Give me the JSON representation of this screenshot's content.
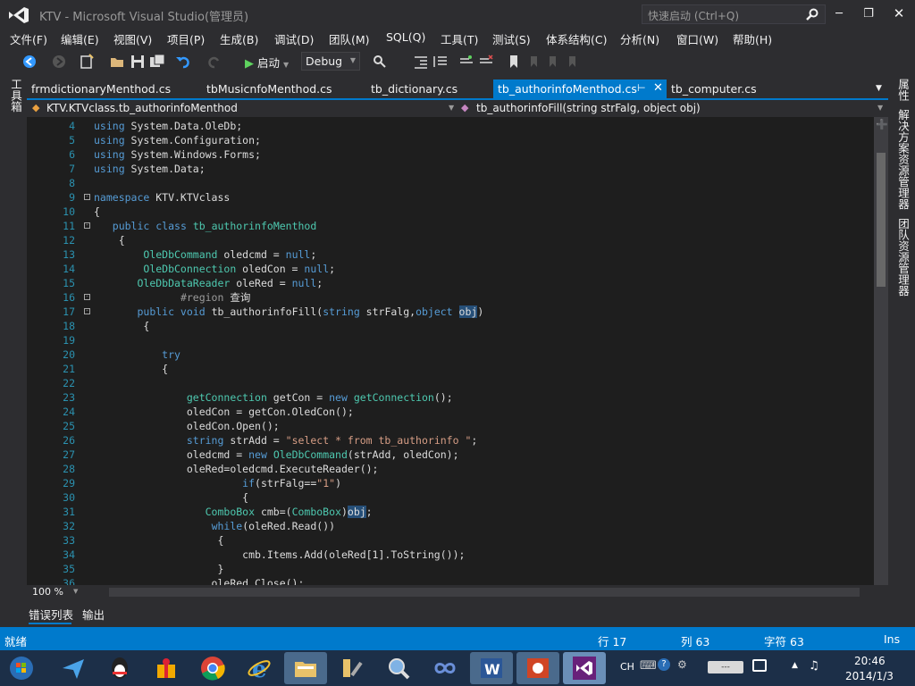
{
  "window": {
    "title": "KTV - Microsoft Visual Studio(管理员)",
    "quick_launch_placeholder": "快速启动 (Ctrl+Q)"
  },
  "menu": [
    "文件(F)",
    "编辑(E)",
    "视图(V)",
    "项目(P)",
    "生成(B)",
    "调试(D)",
    "团队(M)",
    "SQL(Q)",
    "工具(T)",
    "测试(S)",
    "体系结构(C)",
    "分析(N)",
    "窗口(W)",
    "帮助(H)"
  ],
  "toolbar": {
    "start_label": "启动",
    "configuration": "Debug"
  },
  "side_panels": {
    "left": "工具箱",
    "right": [
      "属性",
      "解决方案资源管理器",
      "团队资源管理器"
    ]
  },
  "tabs": [
    {
      "label": "frmdictionaryMenthod.cs",
      "active": false
    },
    {
      "label": "tbMusicnfoMenthod.cs",
      "active": false
    },
    {
      "label": "tb_dictionary.cs",
      "active": false
    },
    {
      "label": "tb_authorinfoMenthod.cs",
      "active": true
    },
    {
      "label": "tb_computer.cs",
      "active": false
    }
  ],
  "navbar": {
    "class": "KTV.KTVclass.tb_authorinfoMenthod",
    "member": "tb_authorinfoFill(string strFalg, object obj)"
  },
  "code": {
    "lines": [
      {
        "n": "4",
        "text": "using System.Data.OleDb;"
      },
      {
        "n": "5",
        "text": "using System.Configuration;"
      },
      {
        "n": "6",
        "text": "using System.Windows.Forms;"
      },
      {
        "n": "7",
        "text": "using System.Data;"
      },
      {
        "n": "8",
        "text": ""
      },
      {
        "n": "9",
        "text": "namespace KTV.KTVclass"
      },
      {
        "n": "10",
        "text": "{"
      },
      {
        "n": "11",
        "text": "   public class tb_authorinfoMenthod"
      },
      {
        "n": "12",
        "text": "    {"
      },
      {
        "n": "13",
        "text": "        OleDbCommand oledcmd = null;"
      },
      {
        "n": "14",
        "text": "        OleDbConnection oledCon = null;"
      },
      {
        "n": "15",
        "text": "       OleDbDataReader oleRed = null;"
      },
      {
        "n": "16",
        "text": "              #region 查询"
      },
      {
        "n": "17",
        "text": "       public void tb_authorinfoFill(string strFalg,object obj)"
      },
      {
        "n": "18",
        "text": "        {"
      },
      {
        "n": "19",
        "text": ""
      },
      {
        "n": "20",
        "text": "           try"
      },
      {
        "n": "21",
        "text": "           {"
      },
      {
        "n": "22",
        "text": ""
      },
      {
        "n": "23",
        "text": "               getConnection getCon = new getConnection();"
      },
      {
        "n": "24",
        "text": "               oledCon = getCon.OledCon();"
      },
      {
        "n": "25",
        "text": "               oledCon.Open();"
      },
      {
        "n": "26",
        "text": "               string strAdd = \"select * from tb_authorinfo \";"
      },
      {
        "n": "27",
        "text": "               oledcmd = new OleDbCommand(strAdd, oledCon);"
      },
      {
        "n": "28",
        "text": "               oleRed=oledcmd.ExecuteReader();"
      },
      {
        "n": "29",
        "text": "                        if(strFalg==\"1\")"
      },
      {
        "n": "30",
        "text": "                        {"
      },
      {
        "n": "31",
        "text": "                  ComboBox cmb=(ComboBox)obj;"
      },
      {
        "n": "32",
        "text": "                   while(oleRed.Read())"
      },
      {
        "n": "33",
        "text": "                    {"
      },
      {
        "n": "34",
        "text": "                        cmb.Items.Add(oleRed[1].ToString());"
      },
      {
        "n": "35",
        "text": "                    }"
      },
      {
        "n": "36",
        "text": "                   oleRed.Close();"
      }
    ]
  },
  "zoom": "100 %",
  "tool_tabs": [
    "错误列表",
    "输出"
  ],
  "status": {
    "ready": "就绪",
    "line": "行 17",
    "col": "列 63",
    "char": "字符 63",
    "mode": "Ins"
  },
  "taskbar": {
    "apps": [
      "start-orb",
      "feiq",
      "qq",
      "gift",
      "chrome",
      "internet-explorer",
      "file-explorer",
      "tools",
      "search",
      "visual-studio-infinity",
      "word",
      "powerpoint",
      "visual-studio"
    ],
    "tray_lang": "CH",
    "time": "20:46",
    "date": "2014/1/3"
  },
  "colors": {
    "accent": "#007acc",
    "editor_bg": "#1e1e1e",
    "chrome_bg": "#2d2d30",
    "keyword": "#569cd6",
    "type": "#4ec9b0",
    "string": "#d69d85",
    "line_number": "#2b91af"
  }
}
